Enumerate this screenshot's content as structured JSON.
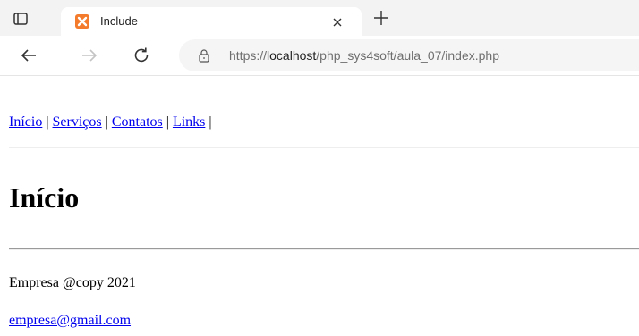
{
  "tab": {
    "title": "Include",
    "favicon": "xampp-icon"
  },
  "toolbar": {
    "url": {
      "scheme": "https://",
      "host": "localhost",
      "path": "/php_sys4soft/aula_07/index.php"
    }
  },
  "page": {
    "menu": [
      {
        "label": "Início"
      },
      {
        "label": "Serviços"
      },
      {
        "label": "Contatos"
      },
      {
        "label": "Links"
      }
    ],
    "menu_separator": "|",
    "heading": "Início",
    "footer": {
      "copyright": "Empresa @copy 2021",
      "email": "empresa@gmail.com"
    }
  },
  "colors": {
    "link": "#0000ee",
    "favicon": "#f37b2b",
    "tabstrip": "#f3f3f3"
  }
}
